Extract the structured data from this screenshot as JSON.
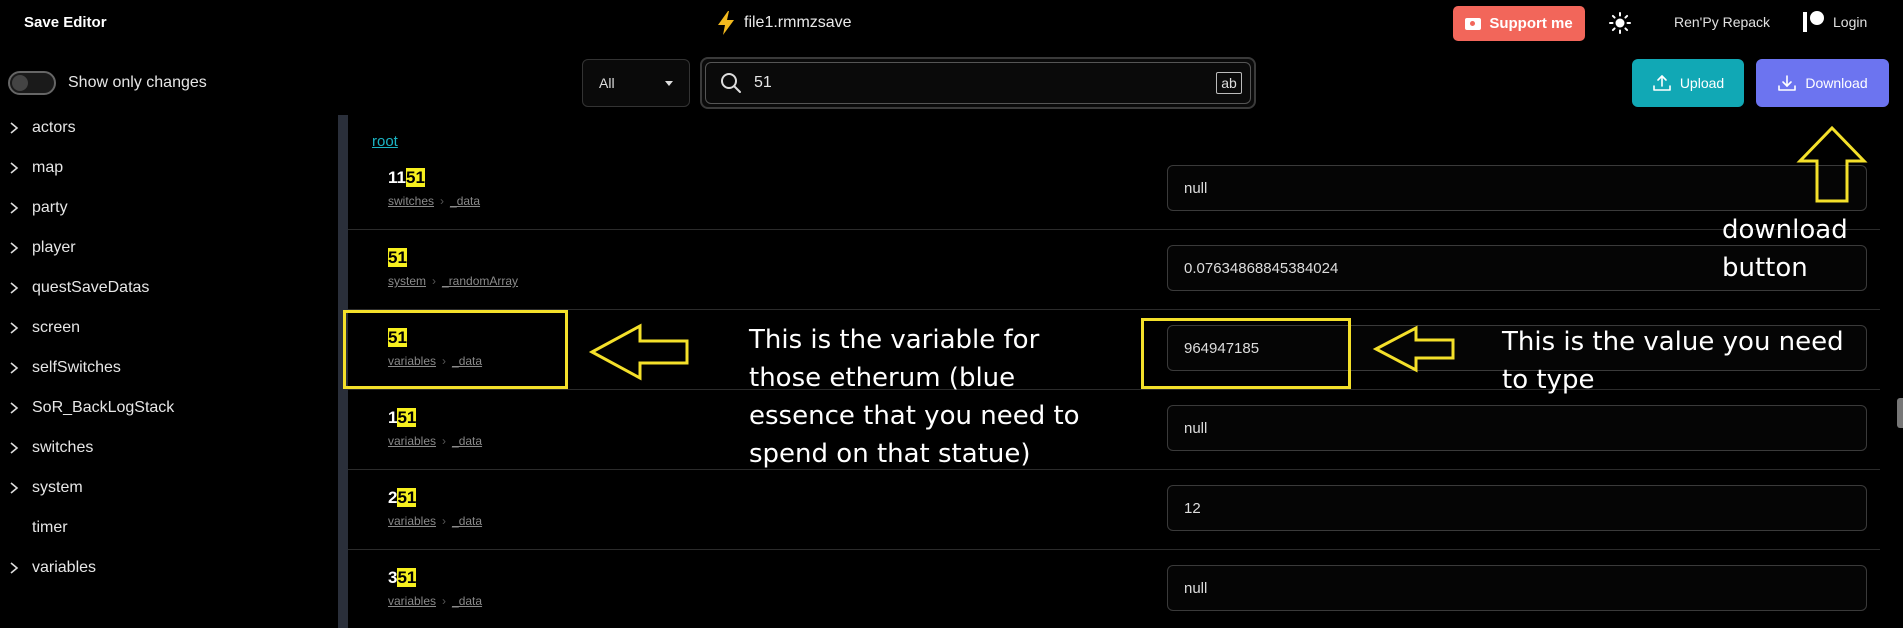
{
  "header": {
    "app_title": "Save Editor",
    "file_name": "file1.rmmzsave",
    "support_label": "Support me",
    "renpy_label": "Ren'Py Repack",
    "login_label": "Login"
  },
  "toolbar": {
    "toggle_label": "Show only changes",
    "filter_value": "All",
    "search_value": "51",
    "case_toggle": "ab",
    "upload_label": "Upload",
    "download_label": "Download"
  },
  "sidebar": {
    "items": [
      {
        "label": "actors",
        "expandable": true
      },
      {
        "label": "map",
        "expandable": true
      },
      {
        "label": "party",
        "expandable": true
      },
      {
        "label": "player",
        "expandable": true
      },
      {
        "label": "questSaveDatas",
        "expandable": true
      },
      {
        "label": "screen",
        "expandable": true
      },
      {
        "label": "selfSwitches",
        "expandable": true
      },
      {
        "label": "SoR_BackLogStack",
        "expandable": true
      },
      {
        "label": "switches",
        "expandable": true
      },
      {
        "label": "system",
        "expandable": true
      },
      {
        "label": "timer",
        "expandable": false
      },
      {
        "label": "variables",
        "expandable": true
      }
    ]
  },
  "main": {
    "root_label": "root",
    "rows": [
      {
        "key_prefix": "11",
        "key_match": "51",
        "path": [
          "switches",
          "_data"
        ],
        "value": "null"
      },
      {
        "key_prefix": "",
        "key_match": "51",
        "path": [
          "system",
          "_randomArray"
        ],
        "value": "0.07634868845384024"
      },
      {
        "key_prefix": "",
        "key_match": "51",
        "path": [
          "variables",
          "_data"
        ],
        "value": "964947185"
      },
      {
        "key_prefix": "1",
        "key_match": "51",
        "path": [
          "variables",
          "_data"
        ],
        "value": "null"
      },
      {
        "key_prefix": "2",
        "key_match": "51",
        "path": [
          "variables",
          "_data"
        ],
        "value": "12"
      },
      {
        "key_prefix": "3",
        "key_match": "51",
        "path": [
          "variables",
          "_data"
        ],
        "value": "null"
      }
    ]
  },
  "annotations": {
    "variable_note": "This is the variable for those etherum (blue essence that you need to spend on that statue)",
    "value_note": "This is the value you need to type",
    "download_note": "download button",
    "color": "#f4e02a"
  },
  "colors": {
    "support": "#f2665a",
    "upload": "#11a8b5",
    "download": "#6c74f0",
    "highlight": "#f7f01e",
    "link": "#1bb5c4"
  }
}
